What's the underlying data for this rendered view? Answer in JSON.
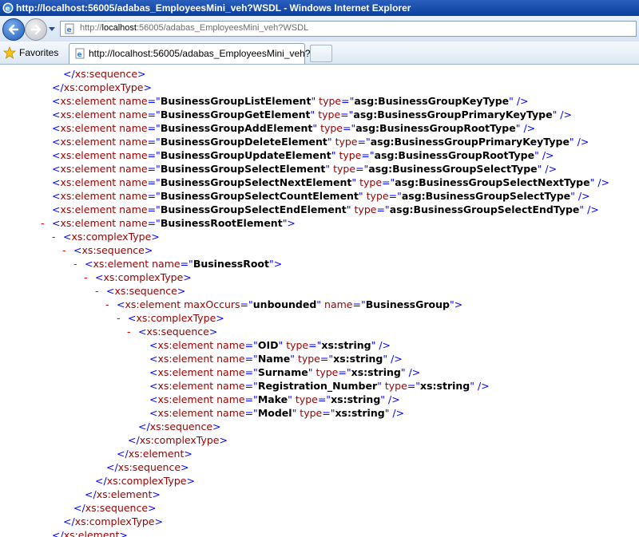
{
  "window": {
    "title": "http://localhost:56005/adabas_EmployeesMini_veh?WSDL - Windows Internet Explorer"
  },
  "nav": {
    "url_prefix": "http://",
    "url_host": "localhost",
    "url_rest": ":56005/adabas_EmployeesMini_veh?WSDL"
  },
  "favorites": {
    "label": "Favorites"
  },
  "tab": {
    "title": "http://localhost:56005/adabas_EmployeesMini_veh?..."
  },
  "icons": {
    "back": "back-arrow-icon",
    "forward": "forward-arrow-icon",
    "favorites": "star-icon",
    "page": "ie-page-icon"
  },
  "colors": {
    "tag": "#990000",
    "punct": "#0000ff",
    "minus": "#e00000",
    "title_bg": "#0a3f9c"
  },
  "xml": {
    "lines": [
      {
        "indent": 79,
        "minus": false,
        "parts": [
          [
            "p",
            "</"
          ],
          [
            "t",
            "xs:sequence"
          ],
          [
            "p",
            ">"
          ]
        ]
      },
      {
        "indent": 65,
        "minus": false,
        "parts": [
          [
            "p",
            "</"
          ],
          [
            "t",
            "xs:complexType"
          ],
          [
            "p",
            ">"
          ]
        ]
      },
      {
        "indent": 65,
        "minus": false,
        "parts": [
          [
            "p",
            "<"
          ],
          [
            "t",
            "xs:element "
          ],
          [
            "a",
            "name"
          ],
          [
            "p",
            "=\""
          ],
          [
            "v",
            "BusinessGroupListElement"
          ],
          [
            "p",
            "\" "
          ],
          [
            "a",
            "type"
          ],
          [
            "p",
            "=\""
          ],
          [
            "v",
            "asg:BusinessGroupKeyType"
          ],
          [
            "p",
            "\" />"
          ]
        ]
      },
      {
        "indent": 65,
        "minus": false,
        "parts": [
          [
            "p",
            "<"
          ],
          [
            "t",
            "xs:element "
          ],
          [
            "a",
            "name"
          ],
          [
            "p",
            "=\""
          ],
          [
            "v",
            "BusinessGroupGetElement"
          ],
          [
            "p",
            "\" "
          ],
          [
            "a",
            "type"
          ],
          [
            "p",
            "=\""
          ],
          [
            "v",
            "asg:BusinessGroupPrimaryKeyType"
          ],
          [
            "p",
            "\" />"
          ]
        ]
      },
      {
        "indent": 65,
        "minus": false,
        "parts": [
          [
            "p",
            "<"
          ],
          [
            "t",
            "xs:element "
          ],
          [
            "a",
            "name"
          ],
          [
            "p",
            "=\""
          ],
          [
            "v",
            "BusinessGroupAddElement"
          ],
          [
            "p",
            "\" "
          ],
          [
            "a",
            "type"
          ],
          [
            "p",
            "=\""
          ],
          [
            "v",
            "asg:BusinessGroupRootType"
          ],
          [
            "p",
            "\" />"
          ]
        ]
      },
      {
        "indent": 65,
        "minus": false,
        "parts": [
          [
            "p",
            "<"
          ],
          [
            "t",
            "xs:element "
          ],
          [
            "a",
            "name"
          ],
          [
            "p",
            "=\""
          ],
          [
            "v",
            "BusinessGroupDeleteElement"
          ],
          [
            "p",
            "\" "
          ],
          [
            "a",
            "type"
          ],
          [
            "p",
            "=\""
          ],
          [
            "v",
            "asg:BusinessGroupPrimaryKeyType"
          ],
          [
            "p",
            "\" />"
          ]
        ]
      },
      {
        "indent": 65,
        "minus": false,
        "parts": [
          [
            "p",
            "<"
          ],
          [
            "t",
            "xs:element "
          ],
          [
            "a",
            "name"
          ],
          [
            "p",
            "=\""
          ],
          [
            "v",
            "BusinessGroupUpdateElement"
          ],
          [
            "p",
            "\" "
          ],
          [
            "a",
            "type"
          ],
          [
            "p",
            "=\""
          ],
          [
            "v",
            "asg:BusinessGroupRootType"
          ],
          [
            "p",
            "\" />"
          ]
        ]
      },
      {
        "indent": 65,
        "minus": false,
        "parts": [
          [
            "p",
            "<"
          ],
          [
            "t",
            "xs:element "
          ],
          [
            "a",
            "name"
          ],
          [
            "p",
            "=\""
          ],
          [
            "v",
            "BusinessGroupSelectElement"
          ],
          [
            "p",
            "\" "
          ],
          [
            "a",
            "type"
          ],
          [
            "p",
            "=\""
          ],
          [
            "v",
            "asg:BusinessGroupSelectType"
          ],
          [
            "p",
            "\" />"
          ]
        ]
      },
      {
        "indent": 65,
        "minus": false,
        "parts": [
          [
            "p",
            "<"
          ],
          [
            "t",
            "xs:element "
          ],
          [
            "a",
            "name"
          ],
          [
            "p",
            "=\""
          ],
          [
            "v",
            "BusinessGroupSelectNextElement"
          ],
          [
            "p",
            "\" "
          ],
          [
            "a",
            "type"
          ],
          [
            "p",
            "=\""
          ],
          [
            "v",
            "asg:BusinessGroupSelectNextType"
          ],
          [
            "p",
            "\" />"
          ]
        ]
      },
      {
        "indent": 65,
        "minus": false,
        "parts": [
          [
            "p",
            "<"
          ],
          [
            "t",
            "xs:element "
          ],
          [
            "a",
            "name"
          ],
          [
            "p",
            "=\""
          ],
          [
            "v",
            "BusinessGroupSelectCountElement"
          ],
          [
            "p",
            "\" "
          ],
          [
            "a",
            "type"
          ],
          [
            "p",
            "=\""
          ],
          [
            "v",
            "asg:BusinessGroupSelectType"
          ],
          [
            "p",
            "\" />"
          ]
        ]
      },
      {
        "indent": 65,
        "minus": false,
        "parts": [
          [
            "p",
            "<"
          ],
          [
            "t",
            "xs:element "
          ],
          [
            "a",
            "name"
          ],
          [
            "p",
            "=\""
          ],
          [
            "v",
            "BusinessGroupSelectEndElement"
          ],
          [
            "p",
            "\" "
          ],
          [
            "a",
            "type"
          ],
          [
            "p",
            "=\""
          ],
          [
            "v",
            "asg:BusinessGroupSelectEndType"
          ],
          [
            "p",
            "\" />"
          ]
        ]
      },
      {
        "indent": 65,
        "minus": true,
        "parts": [
          [
            "p",
            "<"
          ],
          [
            "t",
            "xs:element "
          ],
          [
            "a",
            "name"
          ],
          [
            "p",
            "=\""
          ],
          [
            "v",
            "BusinessRootElement"
          ],
          [
            "p",
            "\">"
          ]
        ]
      },
      {
        "indent": 79,
        "minus": true,
        "parts": [
          [
            "p",
            "<"
          ],
          [
            "t",
            "xs:complexType"
          ],
          [
            "p",
            ">"
          ]
        ]
      },
      {
        "indent": 92,
        "minus": true,
        "parts": [
          [
            "p",
            "<"
          ],
          [
            "t",
            "xs:sequence"
          ],
          [
            "p",
            ">"
          ]
        ]
      },
      {
        "indent": 106,
        "minus": true,
        "parts": [
          [
            "p",
            "<"
          ],
          [
            "t",
            "xs:element "
          ],
          [
            "a",
            "name"
          ],
          [
            "p",
            "=\""
          ],
          [
            "v",
            "BusinessRoot"
          ],
          [
            "p",
            "\">"
          ]
        ]
      },
      {
        "indent": 119,
        "minus": true,
        "parts": [
          [
            "p",
            "<"
          ],
          [
            "t",
            "xs:complexType"
          ],
          [
            "p",
            ">"
          ]
        ]
      },
      {
        "indent": 133,
        "minus": true,
        "parts": [
          [
            "p",
            "<"
          ],
          [
            "t",
            "xs:sequence"
          ],
          [
            "p",
            ">"
          ]
        ]
      },
      {
        "indent": 146,
        "minus": true,
        "parts": [
          [
            "p",
            "<"
          ],
          [
            "t",
            "xs:element "
          ],
          [
            "a",
            "maxOccurs"
          ],
          [
            "p",
            "=\""
          ],
          [
            "v",
            "unbounded"
          ],
          [
            "p",
            "\" "
          ],
          [
            "a",
            "name"
          ],
          [
            "p",
            "=\""
          ],
          [
            "v",
            "BusinessGroup"
          ],
          [
            "p",
            "\">"
          ]
        ]
      },
      {
        "indent": 160,
        "minus": true,
        "parts": [
          [
            "p",
            "<"
          ],
          [
            "t",
            "xs:complexType"
          ],
          [
            "p",
            ">"
          ]
        ]
      },
      {
        "indent": 173,
        "minus": true,
        "parts": [
          [
            "p",
            "<"
          ],
          [
            "t",
            "xs:sequence"
          ],
          [
            "p",
            ">"
          ]
        ]
      },
      {
        "indent": 187,
        "minus": false,
        "parts": [
          [
            "p",
            "<"
          ],
          [
            "t",
            "xs:element "
          ],
          [
            "a",
            "name"
          ],
          [
            "p",
            "=\""
          ],
          [
            "v",
            "OID"
          ],
          [
            "p",
            "\" "
          ],
          [
            "a",
            "type"
          ],
          [
            "p",
            "=\""
          ],
          [
            "v",
            "xs:string"
          ],
          [
            "p",
            "\" />"
          ]
        ]
      },
      {
        "indent": 187,
        "minus": false,
        "parts": [
          [
            "p",
            "<"
          ],
          [
            "t",
            "xs:element "
          ],
          [
            "a",
            "name"
          ],
          [
            "p",
            "=\""
          ],
          [
            "v",
            "Name"
          ],
          [
            "p",
            "\" "
          ],
          [
            "a",
            "type"
          ],
          [
            "p",
            "=\""
          ],
          [
            "v",
            "xs:string"
          ],
          [
            "p",
            "\" />"
          ]
        ]
      },
      {
        "indent": 187,
        "minus": false,
        "parts": [
          [
            "p",
            "<"
          ],
          [
            "t",
            "xs:element "
          ],
          [
            "a",
            "name"
          ],
          [
            "p",
            "=\""
          ],
          [
            "v",
            "Surname"
          ],
          [
            "p",
            "\" "
          ],
          [
            "a",
            "type"
          ],
          [
            "p",
            "=\""
          ],
          [
            "v",
            "xs:string"
          ],
          [
            "p",
            "\" />"
          ]
        ]
      },
      {
        "indent": 187,
        "minus": false,
        "parts": [
          [
            "p",
            "<"
          ],
          [
            "t",
            "xs:element "
          ],
          [
            "a",
            "name"
          ],
          [
            "p",
            "=\""
          ],
          [
            "v",
            "Registration_Number"
          ],
          [
            "p",
            "\" "
          ],
          [
            "a",
            "type"
          ],
          [
            "p",
            "=\""
          ],
          [
            "v",
            "xs:string"
          ],
          [
            "p",
            "\" />"
          ]
        ]
      },
      {
        "indent": 187,
        "minus": false,
        "parts": [
          [
            "p",
            "<"
          ],
          [
            "t",
            "xs:element "
          ],
          [
            "a",
            "name"
          ],
          [
            "p",
            "=\""
          ],
          [
            "v",
            "Make"
          ],
          [
            "p",
            "\" "
          ],
          [
            "a",
            "type"
          ],
          [
            "p",
            "=\""
          ],
          [
            "v",
            "xs:string"
          ],
          [
            "p",
            "\" />"
          ]
        ]
      },
      {
        "indent": 187,
        "minus": false,
        "parts": [
          [
            "p",
            "<"
          ],
          [
            "t",
            "xs:element "
          ],
          [
            "a",
            "name"
          ],
          [
            "p",
            "=\""
          ],
          [
            "v",
            "Model"
          ],
          [
            "p",
            "\" "
          ],
          [
            "a",
            "type"
          ],
          [
            "p",
            "=\""
          ],
          [
            "v",
            "xs:string"
          ],
          [
            "p",
            "\" />"
          ]
        ]
      },
      {
        "indent": 173,
        "minus": false,
        "parts": [
          [
            "p",
            "</"
          ],
          [
            "t",
            "xs:sequence"
          ],
          [
            "p",
            ">"
          ]
        ]
      },
      {
        "indent": 160,
        "minus": false,
        "parts": [
          [
            "p",
            "</"
          ],
          [
            "t",
            "xs:complexType"
          ],
          [
            "p",
            ">"
          ]
        ]
      },
      {
        "indent": 146,
        "minus": false,
        "parts": [
          [
            "p",
            "</"
          ],
          [
            "t",
            "xs:element"
          ],
          [
            "p",
            ">"
          ]
        ]
      },
      {
        "indent": 133,
        "minus": false,
        "parts": [
          [
            "p",
            "</"
          ],
          [
            "t",
            "xs:sequence"
          ],
          [
            "p",
            ">"
          ]
        ]
      },
      {
        "indent": 119,
        "minus": false,
        "parts": [
          [
            "p",
            "</"
          ],
          [
            "t",
            "xs:complexType"
          ],
          [
            "p",
            ">"
          ]
        ]
      },
      {
        "indent": 106,
        "minus": false,
        "parts": [
          [
            "p",
            "</"
          ],
          [
            "t",
            "xs:element"
          ],
          [
            "p",
            ">"
          ]
        ]
      },
      {
        "indent": 92,
        "minus": false,
        "parts": [
          [
            "p",
            "</"
          ],
          [
            "t",
            "xs:sequence"
          ],
          [
            "p",
            ">"
          ]
        ]
      },
      {
        "indent": 79,
        "minus": false,
        "parts": [
          [
            "p",
            "</"
          ],
          [
            "t",
            "xs:complexType"
          ],
          [
            "p",
            ">"
          ]
        ]
      },
      {
        "indent": 65,
        "minus": false,
        "parts": [
          [
            "p",
            "</"
          ],
          [
            "t",
            "xs:element"
          ],
          [
            "p",
            ">"
          ]
        ]
      }
    ]
  }
}
